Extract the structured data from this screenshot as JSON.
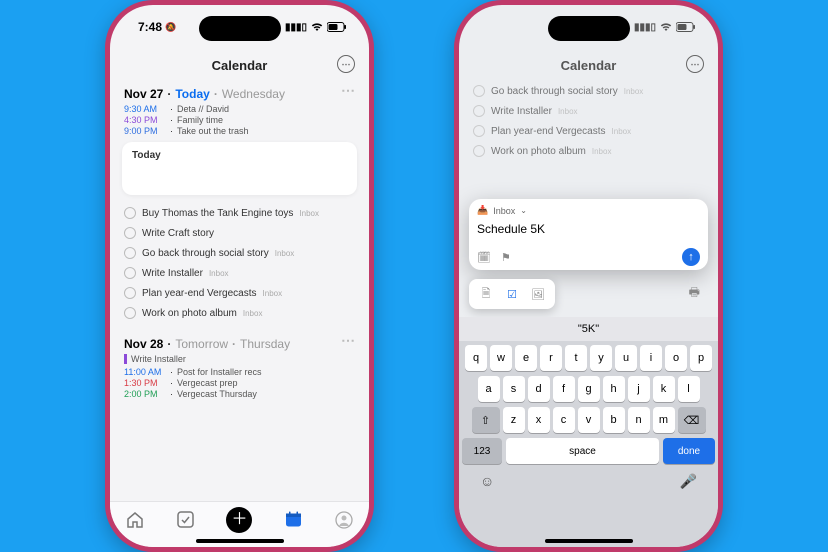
{
  "status": {
    "time": "7:48",
    "bell": "🔕"
  },
  "header": {
    "title": "Calendar"
  },
  "phone1": {
    "day1": {
      "datenum": "Nov 27",
      "label": "Today",
      "weekday": "Wednesday",
      "events": [
        {
          "time": "9:30 AM",
          "title": "Deta // David",
          "cls": "blue"
        },
        {
          "time": "4:30 PM",
          "title": "Family time",
          "cls": "purple"
        },
        {
          "time": "9:00 PM",
          "title": "Take out the trash",
          "cls": "blue2"
        }
      ],
      "card_label": "Today",
      "tasks": [
        {
          "title": "Buy Thomas the Tank Engine toys",
          "tag": "Inbox"
        },
        {
          "title": "Write Craft story",
          "tag": ""
        },
        {
          "title": "Go back through social story",
          "tag": "Inbox"
        },
        {
          "title": "Write Installer",
          "tag": "Inbox"
        },
        {
          "title": "Plan year-end Vergecasts",
          "tag": "Inbox"
        },
        {
          "title": "Work on photo album",
          "tag": "Inbox"
        }
      ]
    },
    "day2": {
      "datenum": "Nov 28",
      "label": "Tomorrow",
      "weekday": "Thursday",
      "bar_event": "Write Installer",
      "events": [
        {
          "time": "11:00 AM",
          "title": "Post for Installer recs",
          "cls": "blue"
        },
        {
          "time": "1:30 PM",
          "title": "Vergecast prep",
          "cls": "red"
        },
        {
          "time": "2:00 PM",
          "title": "Vergecast Thursday",
          "cls": "green"
        }
      ]
    }
  },
  "phone2": {
    "bg_tasks": [
      {
        "title": "Go back through social story",
        "tag": "Inbox"
      },
      {
        "title": "Write Installer",
        "tag": "Inbox"
      },
      {
        "title": "Plan year-end Vergecasts",
        "tag": "Inbox"
      },
      {
        "title": "Work on photo album",
        "tag": "Inbox"
      }
    ],
    "compose": {
      "list_label": "Inbox",
      "text": "Schedule 5K"
    },
    "suggestion": "\"5K\"",
    "keyboard": {
      "row1": [
        "q",
        "w",
        "e",
        "r",
        "t",
        "y",
        "u",
        "i",
        "o",
        "p"
      ],
      "row2": [
        "a",
        "s",
        "d",
        "f",
        "g",
        "h",
        "j",
        "k",
        "l"
      ],
      "row3": [
        "⇧",
        "z",
        "x",
        "c",
        "v",
        "b",
        "n",
        "m",
        "⌫"
      ],
      "num": "123",
      "space": "space",
      "done": "done"
    }
  }
}
